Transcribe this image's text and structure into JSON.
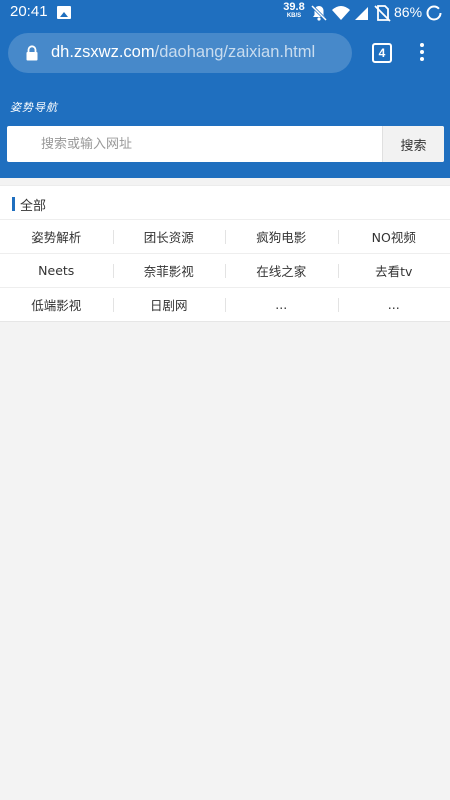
{
  "status_bar": {
    "time": "20:41",
    "net_speed": "39.8",
    "net_speed_unit": "KB/S",
    "battery": "86%"
  },
  "browser": {
    "url_domain": "dh.zsxwz.com",
    "url_path": "/daohang/zaixian.html",
    "tab_count": "4"
  },
  "site": {
    "logo": "姿势导航",
    "search_placeholder": "搜索或输入网址",
    "search_button": "搜索"
  },
  "category": {
    "title": "全部",
    "rows": [
      [
        "姿势解析",
        "团长资源",
        "疯狗电影",
        "NO视频"
      ],
      [
        "Neets",
        "奈菲影视",
        "在线之家",
        "去看tv"
      ],
      [
        "低端影视",
        "日剧网",
        "...",
        "..."
      ]
    ]
  }
}
